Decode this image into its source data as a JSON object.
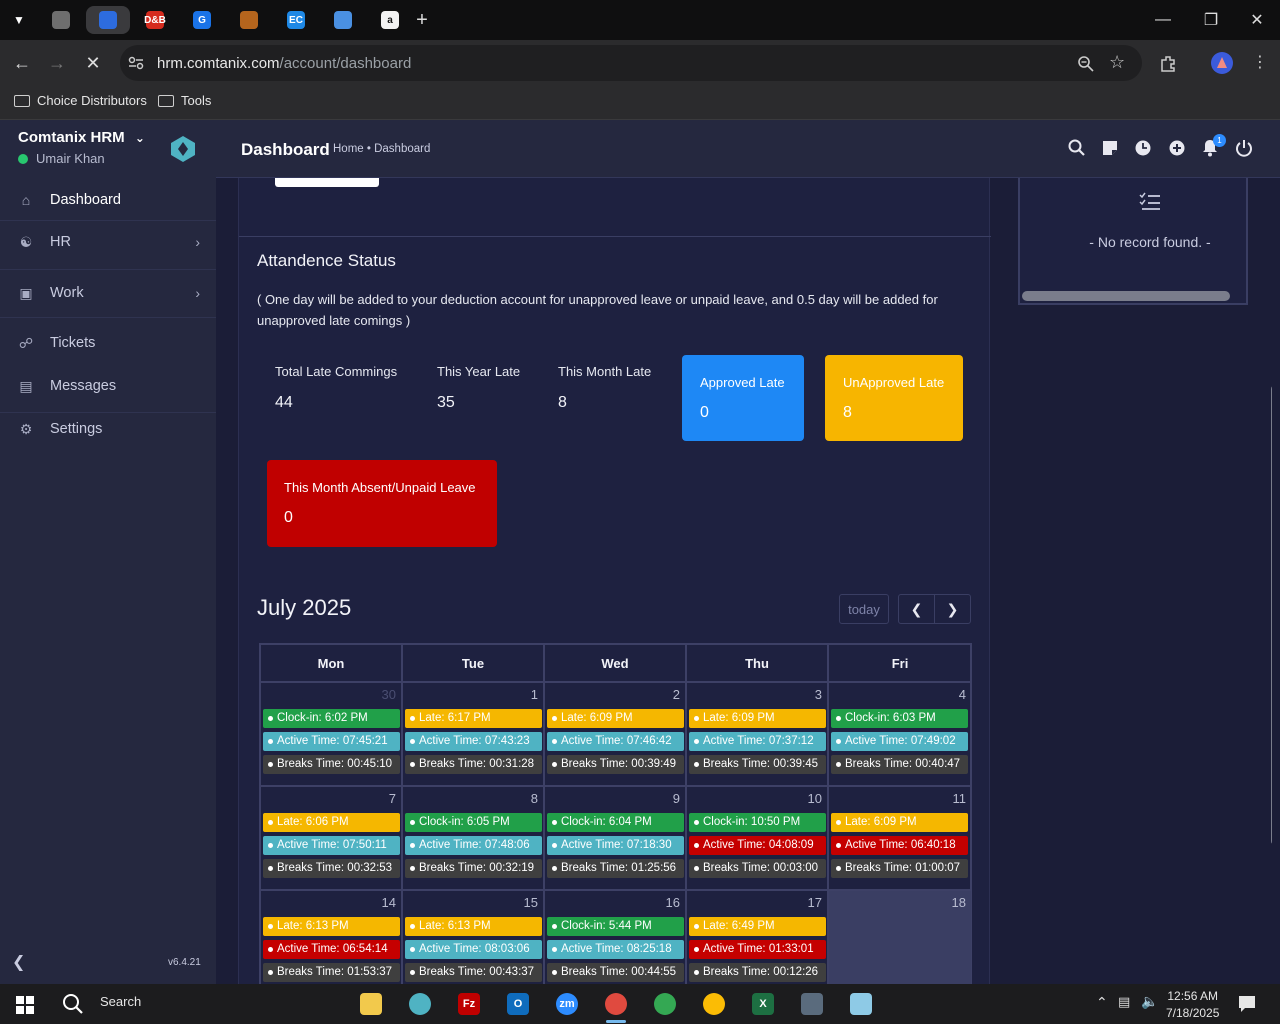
{
  "browser": {
    "tabs": [
      {
        "icon": "target-icon",
        "color": "#6e6e6e"
      },
      {
        "icon": "bullseye-icon",
        "color": "#2d6cdf",
        "active": true
      },
      {
        "icon": "dandb-icon",
        "label": "D&B",
        "color": "#d52b1e"
      },
      {
        "icon": "g-icon",
        "label": "G",
        "color": "#1a73e8"
      },
      {
        "icon": "box-icon",
        "color": "#b5651d"
      },
      {
        "icon": "ec-icon",
        "label": "EC",
        "color": "#1e88e5"
      },
      {
        "icon": "loading-icon",
        "color": "#4a90e2"
      },
      {
        "icon": "amazon-icon",
        "label": "a",
        "color": "#f2f2f2"
      }
    ],
    "url_host": "hrm.comtanix.com",
    "url_path": "/account/dashboard",
    "bookmarks": [
      "Choice Distributors",
      "Tools"
    ]
  },
  "sidebar": {
    "brand": "Comtanix HRM",
    "user": "Umair Khan",
    "items": [
      {
        "label": "Dashboard",
        "icon": "home-icon"
      },
      {
        "label": "HR",
        "icon": "users-icon"
      },
      {
        "label": "Work",
        "icon": "briefcase-icon"
      },
      {
        "label": "Tickets",
        "icon": "headset-icon"
      },
      {
        "label": "Messages",
        "icon": "message-icon"
      },
      {
        "label": "Settings",
        "icon": "gear-icon"
      }
    ],
    "version": "v6.4.21"
  },
  "header": {
    "title": "Dashboard",
    "breadcrumb": "Home • Dashboard",
    "notification_count": "1"
  },
  "attendance": {
    "title": "Attandence Status",
    "note": "( One day will be added to your deduction account for unapproved leave or unpaid leave, and 0.5 day will be added for unapproved late comings )",
    "total_late_label": "Total Late Commings",
    "total_late_value": "44",
    "year_late_label": "This Year Late",
    "year_late_value": "35",
    "month_late_label": "This Month Late",
    "month_late_value": "8",
    "approved_label": "Approved Late",
    "approved_value": "0",
    "approved_color": "#1e88f5",
    "unapproved_label": "UnApproved Late",
    "unapproved_value": "8",
    "unapproved_color": "#f7b500",
    "absent_label": "This Month Absent/Unpaid Leave",
    "absent_value": "0",
    "absent_color": "#c00000"
  },
  "calendar": {
    "title": "July 2025",
    "today_label": "today",
    "days": [
      "Mon",
      "Tue",
      "Wed",
      "Thu",
      "Fri"
    ],
    "weeks": [
      [
        {
          "day": "30",
          "other": true,
          "events": [
            [
              "green",
              "Clock-in: 6:02 PM"
            ],
            [
              "teal",
              "Active Time: 07:45:21"
            ],
            [
              "grey",
              "Breaks Time: 00:45:10"
            ]
          ]
        },
        {
          "day": "1",
          "events": [
            [
              "yellow",
              "Late: 6:17 PM"
            ],
            [
              "teal",
              "Active Time: 07:43:23"
            ],
            [
              "grey",
              "Breaks Time: 00:31:28"
            ]
          ]
        },
        {
          "day": "2",
          "events": [
            [
              "yellow",
              "Late: 6:09 PM"
            ],
            [
              "teal",
              "Active Time: 07:46:42"
            ],
            [
              "grey",
              "Breaks Time: 00:39:49"
            ]
          ]
        },
        {
          "day": "3",
          "events": [
            [
              "yellow",
              "Late: 6:09 PM"
            ],
            [
              "teal",
              "Active Time: 07:37:12"
            ],
            [
              "grey",
              "Breaks Time: 00:39:45"
            ]
          ]
        },
        {
          "day": "4",
          "events": [
            [
              "green",
              "Clock-in: 6:03 PM"
            ],
            [
              "teal",
              "Active Time: 07:49:02"
            ],
            [
              "grey",
              "Breaks Time: 00:40:47"
            ]
          ]
        }
      ],
      [
        {
          "day": "7",
          "events": [
            [
              "yellow",
              "Late: 6:06 PM"
            ],
            [
              "teal",
              "Active Time: 07:50:11"
            ],
            [
              "grey",
              "Breaks Time: 00:32:53"
            ]
          ]
        },
        {
          "day": "8",
          "events": [
            [
              "green",
              "Clock-in: 6:05 PM"
            ],
            [
              "teal",
              "Active Time: 07:48:06"
            ],
            [
              "grey",
              "Breaks Time: 00:32:19"
            ]
          ]
        },
        {
          "day": "9",
          "events": [
            [
              "green",
              "Clock-in: 6:04 PM"
            ],
            [
              "teal",
              "Active Time: 07:18:30"
            ],
            [
              "grey",
              "Breaks Time: 01:25:56"
            ]
          ]
        },
        {
          "day": "10",
          "events": [
            [
              "green",
              "Clock-in: 10:50 PM"
            ],
            [
              "red",
              "Active Time: 04:08:09"
            ],
            [
              "grey",
              "Breaks Time: 00:03:00"
            ]
          ]
        },
        {
          "day": "11",
          "events": [
            [
              "yellow",
              "Late: 6:09 PM"
            ],
            [
              "red",
              "Active Time: 06:40:18"
            ],
            [
              "grey",
              "Breaks Time: 01:00:07"
            ]
          ]
        }
      ],
      [
        {
          "day": "14",
          "events": [
            [
              "yellow",
              "Late: 6:13 PM"
            ],
            [
              "red",
              "Active Time: 06:54:14"
            ],
            [
              "grey",
              "Breaks Time: 01:53:37"
            ]
          ]
        },
        {
          "day": "15",
          "events": [
            [
              "yellow",
              "Late: 6:13 PM"
            ],
            [
              "teal",
              "Active Time: 08:03:06"
            ],
            [
              "grey",
              "Breaks Time: 00:43:37"
            ]
          ]
        },
        {
          "day": "16",
          "events": [
            [
              "green",
              "Clock-in: 5:44 PM"
            ],
            [
              "teal",
              "Active Time: 08:25:18"
            ],
            [
              "grey",
              "Breaks Time: 00:44:55"
            ]
          ]
        },
        {
          "day": "17",
          "events": [
            [
              "yellow",
              "Late: 6:49 PM"
            ],
            [
              "red",
              "Active Time: 01:33:01"
            ],
            [
              "grey",
              "Breaks Time: 00:12:26"
            ]
          ]
        },
        {
          "day": "18",
          "today": true,
          "events": []
        }
      ]
    ]
  },
  "right_panel": {
    "empty_text": "- No record found. -"
  },
  "taskbar": {
    "search_label": "Search",
    "apps": [
      {
        "icon": "file-explorer-icon",
        "color": "#f2c94c"
      },
      {
        "icon": "hrm-app-icon",
        "color": "#4fb3c3"
      },
      {
        "icon": "filezilla-icon",
        "label": "Fz",
        "color": "#bf0000"
      },
      {
        "icon": "outlook-icon",
        "label": "O",
        "color": "#0f6cbd"
      },
      {
        "icon": "zoom-icon",
        "label": "zm",
        "color": "#2d8cff"
      },
      {
        "icon": "chrome-icon",
        "color": "#e04a3f",
        "active": true
      },
      {
        "icon": "chrome-icon-2",
        "color": "#34a853"
      },
      {
        "icon": "chrome-icon-3",
        "color": "#fbbc05"
      },
      {
        "icon": "excel-icon",
        "label": "X",
        "color": "#1d6f42"
      },
      {
        "icon": "calculator-icon",
        "color": "#5a6b7d"
      },
      {
        "icon": "notepad-icon",
        "color": "#8ecae6"
      }
    ],
    "time": "12:56 AM",
    "date": "7/18/2025"
  }
}
